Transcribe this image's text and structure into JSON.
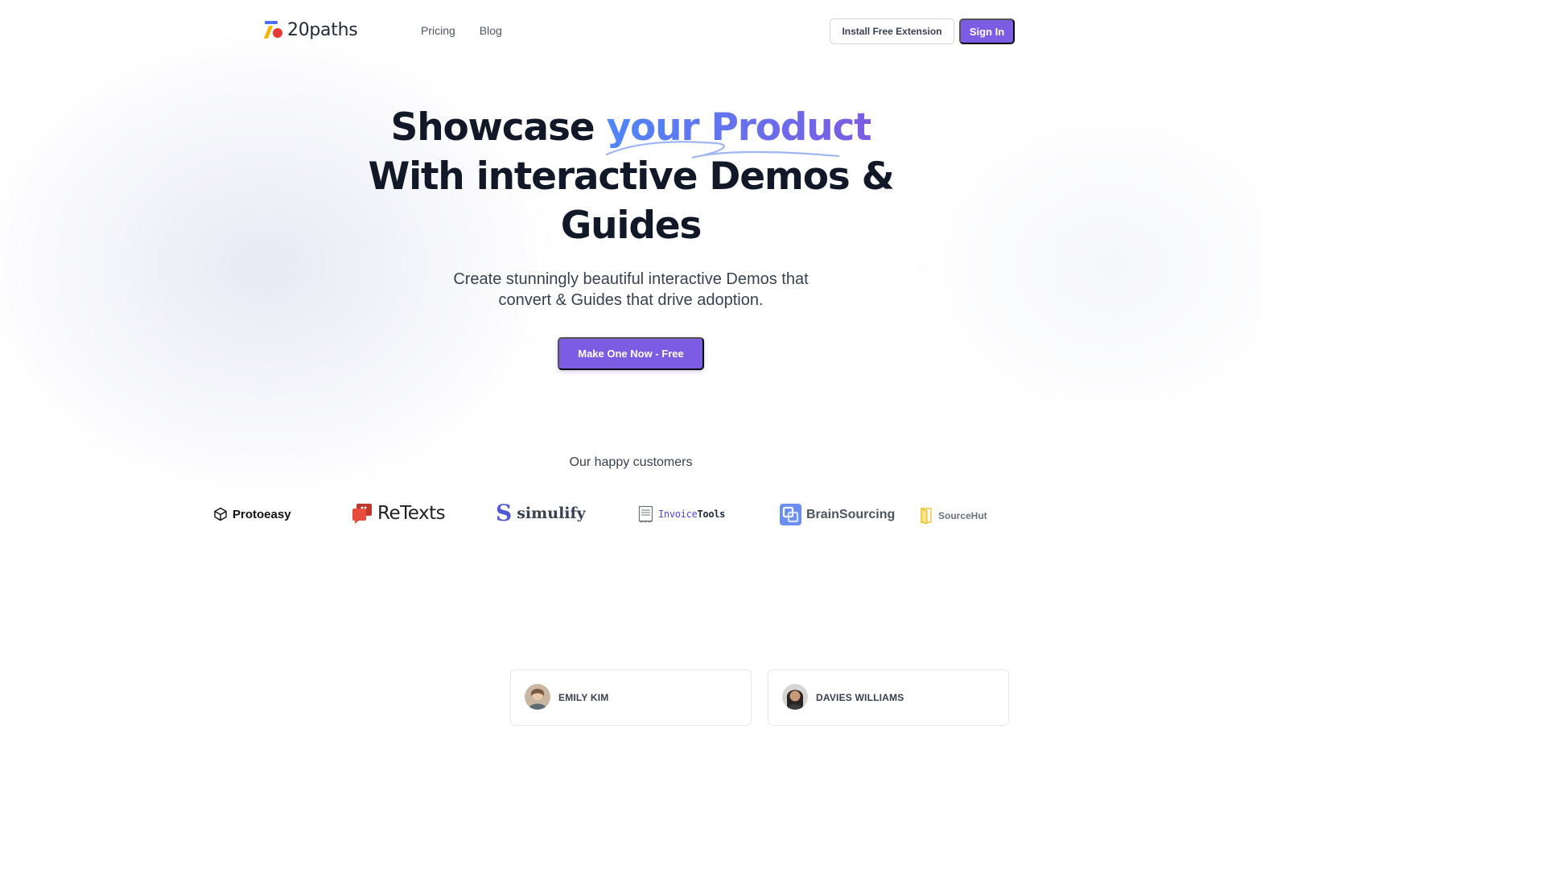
{
  "brand": {
    "name": "20paths"
  },
  "nav": {
    "links": [
      "Pricing",
      "Blog"
    ],
    "install_label": "Install Free Extension",
    "signin_label": "Sign In"
  },
  "hero": {
    "headline_part1": "Showcase ",
    "headline_accent": "your Product",
    "headline_line2": "With interactive Demos &",
    "headline_line3": "Guides",
    "subhead_line1": "Create stunningly beautiful interactive Demos that",
    "subhead_line2": "convert & Guides that drive adoption.",
    "cta_label": "Make One Now - Free"
  },
  "customers": {
    "title": "Our happy customers",
    "logos": [
      {
        "name": "Protoeasy",
        "icon": "cube-icon"
      },
      {
        "name": "ReTexts",
        "icon": "chat-bubble-icon"
      },
      {
        "name": "simulify",
        "icon": "s-letter-icon"
      },
      {
        "name_part1": "Invoice",
        "name_part2": "Tools",
        "icon": "receipt-icon"
      },
      {
        "name": "BrainSourcing",
        "icon": "squares-icon"
      },
      {
        "name": "SourceHut",
        "icon": "door-icon"
      }
    ]
  },
  "testimonials": [
    {
      "name": "EMILY KIM"
    },
    {
      "name": "DAVIES WILLIAMS"
    }
  ],
  "colors": {
    "primary": "#7c5ce3",
    "accent_start": "#4f86f7",
    "accent_end": "#7c5ce3",
    "text_dark": "#111827"
  }
}
